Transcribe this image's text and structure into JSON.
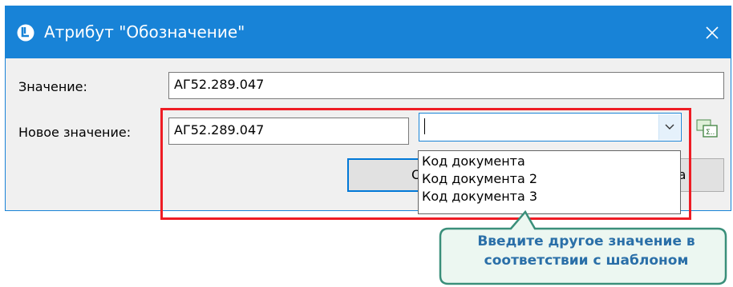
{
  "window": {
    "title": "Атрибут \"Обозначение\"",
    "icon": "app-logo-icon",
    "close_icon": "close-icon"
  },
  "value_row": {
    "label": "Значение:",
    "value": "АГ52.289.047"
  },
  "new_value_row": {
    "label": "Новое значение:",
    "value": "АГ52.289.047",
    "combo_value": "",
    "combo_arrow_icon": "chevron-down-icon",
    "expression_icon": "expression-editor-icon"
  },
  "buttons": {
    "ok_label": "ОК",
    "cancel_label": "Отмена",
    "cancel_visible": "ка"
  },
  "dropdown": {
    "options": [
      "Код документа",
      "Код документа 2",
      "Код документа 3"
    ]
  },
  "tooltip": {
    "line1": "Введите другое значение в",
    "line2": "соответствии с шаблоном",
    "border_color": "#3a8f7a",
    "fill_color": "#ecf7f1",
    "text_color": "#2a6fa8"
  },
  "colors": {
    "accent": "#1883d7",
    "highlight": "#ee1c24"
  }
}
